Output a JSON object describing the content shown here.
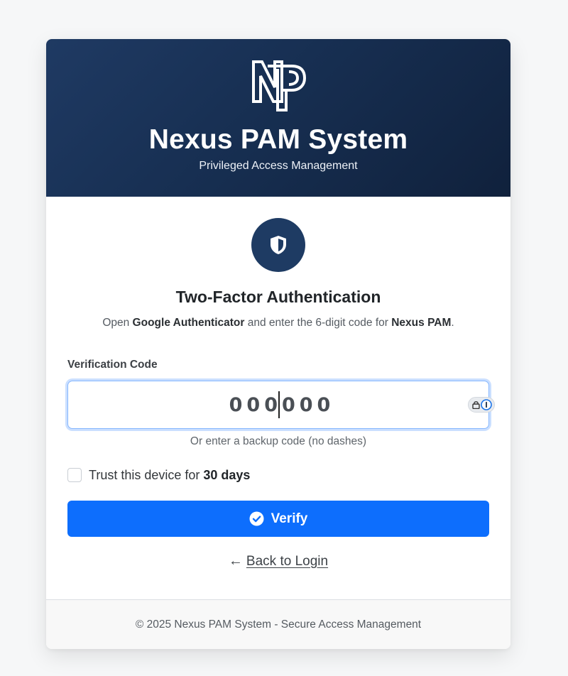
{
  "colors": {
    "header_bg": "#172f52",
    "shield_bg": "#1e3b63",
    "primary": "#0d6efd",
    "input_focus": "#86b7fe"
  },
  "header": {
    "title": "Nexus PAM System",
    "subtitle": "Privileged Access Management",
    "logo": "np-monogram-logo"
  },
  "auth": {
    "icon": "shield-icon",
    "heading": "Two-Factor Authentication",
    "instruction": {
      "prefix": "Open ",
      "app_name": "Google Authenticator",
      "middle": " and enter the 6-digit code for ",
      "service_name": "Nexus PAM",
      "suffix": "."
    }
  },
  "form": {
    "code_label": "Verification Code",
    "code_placeholder": "000000",
    "password_manager_icon": "lock-info-icon",
    "backup_hint": "Or enter a backup code (no dashes)",
    "trust_device": {
      "label_prefix": "Trust this device for ",
      "label_duration": "30 days",
      "checked": false
    },
    "verify_label": "Verify",
    "verify_icon": "check-circle-icon",
    "back_label": "Back to Login",
    "back_arrow": "←"
  },
  "footer": {
    "text": "© 2025 Nexus PAM System - Secure Access Management"
  }
}
